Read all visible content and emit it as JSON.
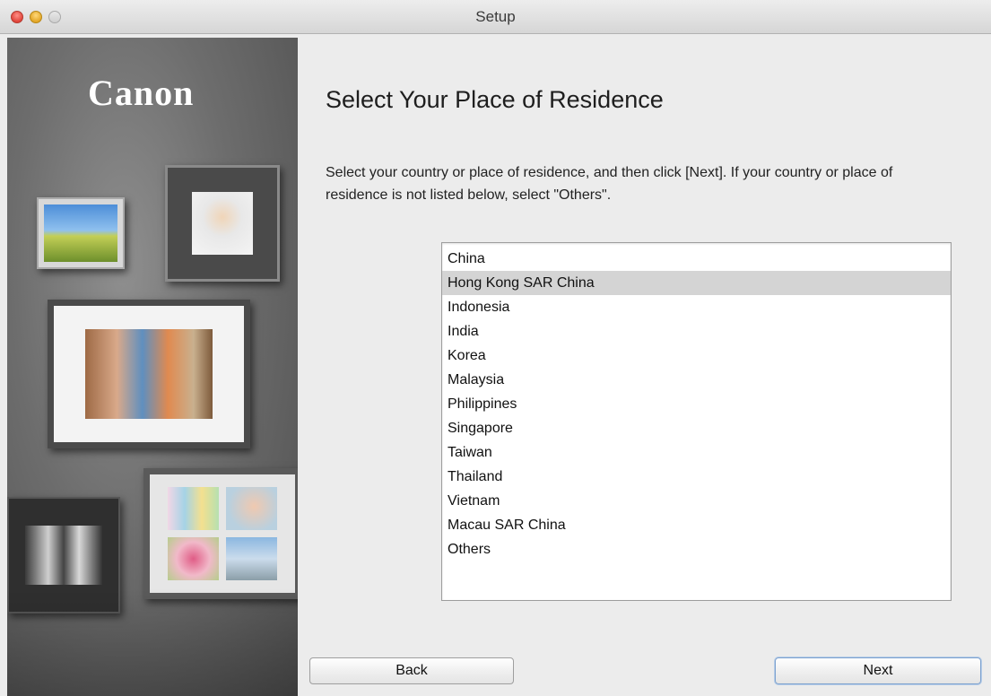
{
  "window": {
    "title": "Setup"
  },
  "side": {
    "logo_text": "Canon"
  },
  "main": {
    "heading": "Select Your Place of Residence",
    "description": "Select your country or place of residence, and then click [Next]. If your country or place of residence is not listed below, select \"Others\".",
    "countries": [
      "China",
      "Hong Kong SAR China",
      "Indonesia",
      "India",
      "Korea",
      "Malaysia",
      "Philippines",
      "Singapore",
      "Taiwan",
      "Thailand",
      "Vietnam",
      "Macau SAR China",
      "Others"
    ],
    "selected_country": "Hong Kong SAR China"
  },
  "buttons": {
    "back_label": "Back",
    "next_label": "Next"
  }
}
